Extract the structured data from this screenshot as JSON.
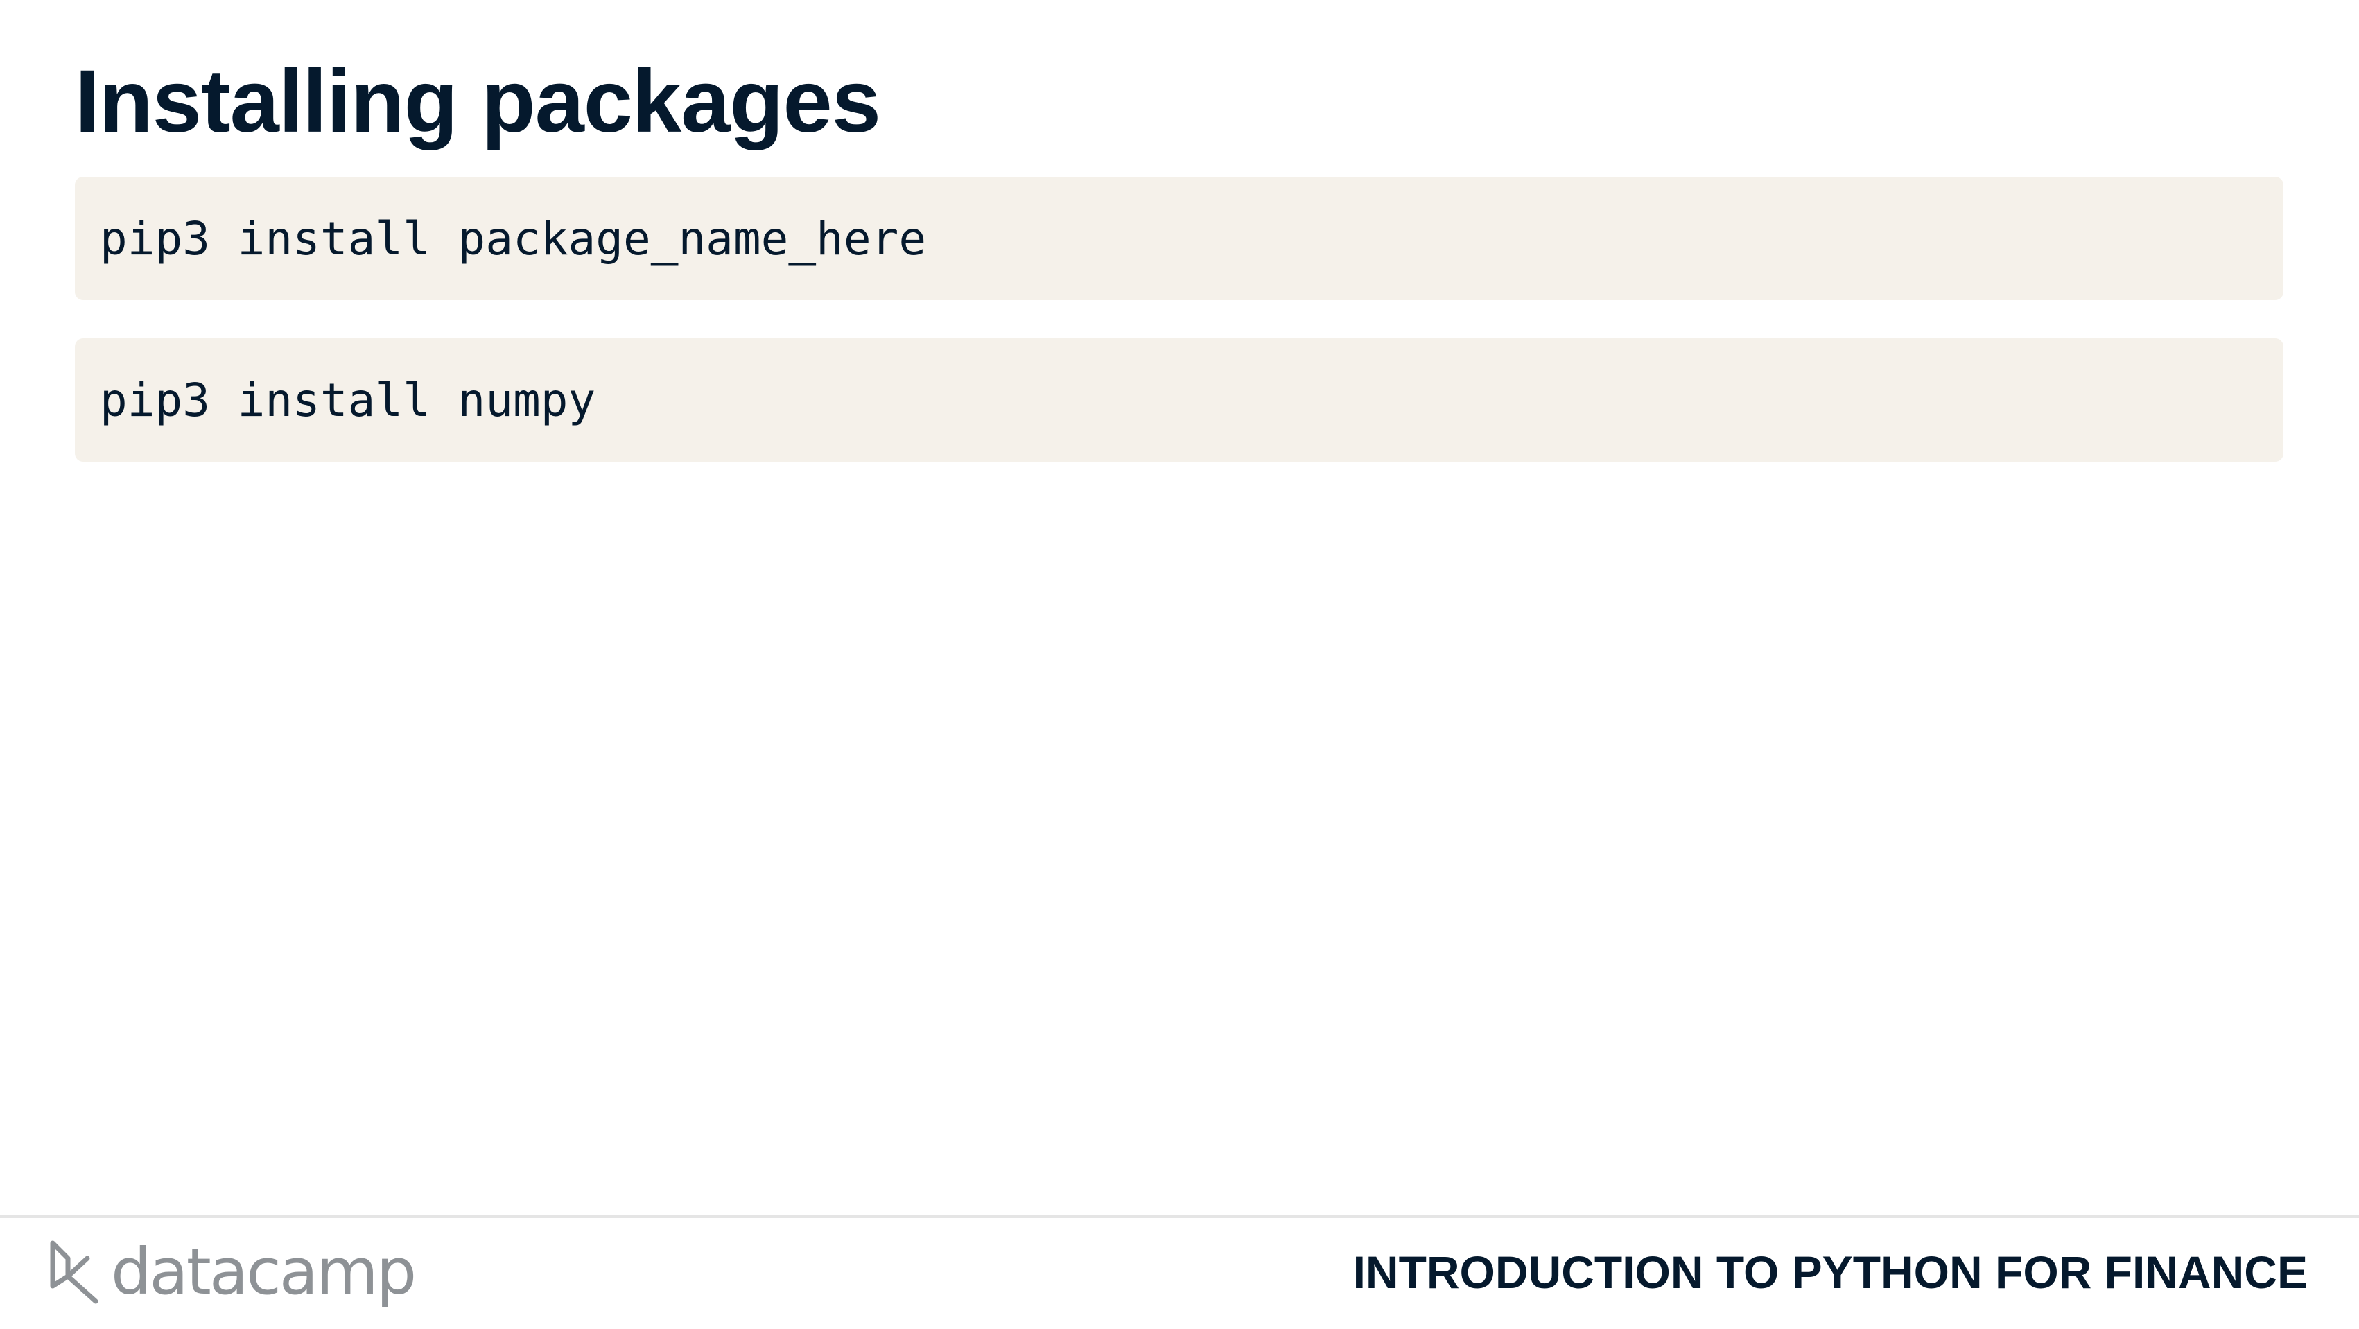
{
  "slide": {
    "title": "Installing packages"
  },
  "code_blocks": [
    {
      "code": "pip3 install package_name_here"
    },
    {
      "code": "pip3 install numpy"
    }
  ],
  "footer": {
    "brand_name": "datacamp",
    "brand_icon": "datacamp-logo-icon",
    "course_title": "INTRODUCTION TO PYTHON FOR FINANCE"
  },
  "colors": {
    "text": "#05192d",
    "code_background": "#f5f1ea",
    "brand_gray": "#8e9296",
    "divider": "#e5e5e5"
  }
}
